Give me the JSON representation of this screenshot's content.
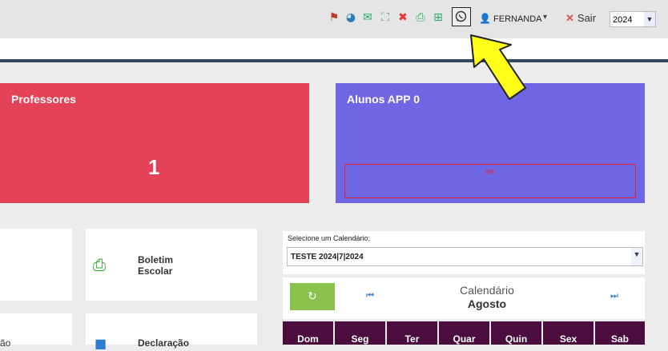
{
  "header": {
    "icons": [
      "pin-icon",
      "pie-chart-icon",
      "chat-icon",
      "fullscreen-icon",
      "close-circle-icon",
      "print-icon",
      "table-icon",
      "whatsapp-icon"
    ],
    "user_name": "FERNANDA",
    "logout_label": "Sair",
    "year": "2024"
  },
  "cards": {
    "professores": {
      "title": "Professores",
      "count": "1"
    },
    "alunos_app": {
      "title": "Alunos APP 0",
      "progress_label": "0%",
      "progress": 0
    }
  },
  "tiles": {
    "boletim": "Boletim\nEscolar",
    "declaracao": "Declaração",
    "partial_left_bottom": "ão"
  },
  "calendar": {
    "select_label": "Selecione um Calendário:",
    "selected": "TESTE 2024|7|2024",
    "title": "Calendário",
    "month": "Agosto",
    "weekdays": [
      "Dom",
      "Seg",
      "Ter",
      "Quar",
      "Quin",
      "Sex",
      "Sab"
    ]
  },
  "colors": {
    "professores_bg": "#e44257",
    "alunos_bg": "#6f66e4",
    "calendar_header_bg": "#4a0d3e",
    "refresh_bg": "#8bc14d"
  }
}
